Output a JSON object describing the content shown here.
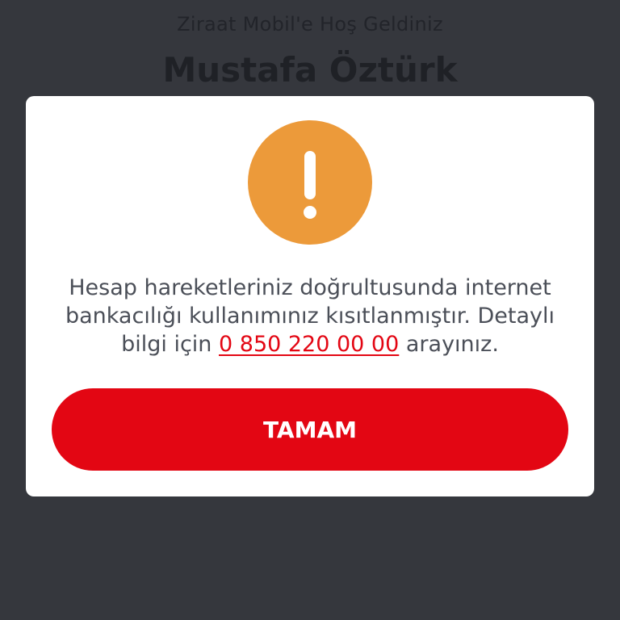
{
  "background": {
    "welcome_text": "Ziraat Mobil'e Hoş Geldiniz",
    "user_name": "Mustafa Öztürk"
  },
  "dialog": {
    "icon": "exclamation-icon",
    "icon_color": "#ec9a3a",
    "message_part1": "Hesap hareketleriniz doğrultusunda internet bankacılığı kullanımınız kısıtlanmıştır. Detaylı bilgi için ",
    "phone_number": "0 850 220 00 00",
    "message_part2": " arayınız.",
    "button_label": "TAMAM",
    "button_color": "#e30613"
  }
}
